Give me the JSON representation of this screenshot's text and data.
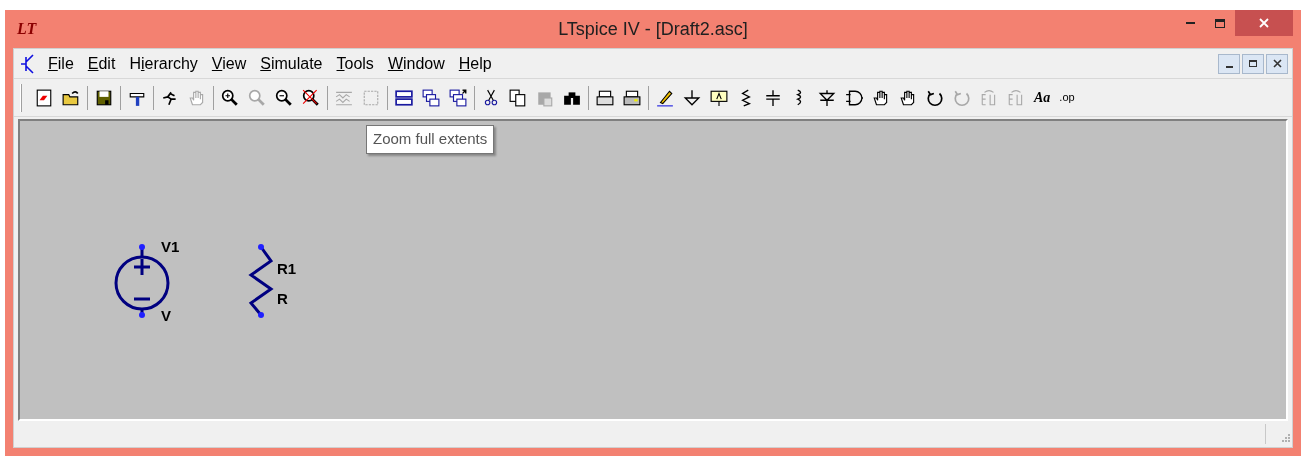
{
  "window": {
    "logo": "LT",
    "title": "LTspice IV - [Draft2.asc]"
  },
  "menu": [
    {
      "key": "F",
      "after": "ile"
    },
    {
      "key": "E",
      "after": "dit"
    },
    {
      "before": "H",
      "key": "i",
      "after": "erarchy"
    },
    {
      "key": "V",
      "after": "iew"
    },
    {
      "key": "S",
      "after": "imulate"
    },
    {
      "key": "T",
      "after": "ools"
    },
    {
      "key": "W",
      "after": "indow"
    },
    {
      "key": "H",
      "after": "elp"
    }
  ],
  "toolbar": [
    [
      {
        "disabled": false
      },
      {
        "disabled": false
      }
    ],
    [
      {
        "disabled": false
      }
    ],
    [
      {
        "disabled": false
      }
    ],
    [
      {
        "disabled": false
      },
      {
        "disabled": true
      }
    ],
    [
      {
        "disabled": false
      },
      {
        "disabled": true
      },
      {
        "disabled": false
      },
      {
        "disabled": false
      }
    ],
    [
      {
        "disabled": true
      },
      {
        "disabled": true
      }
    ],
    [
      {
        "disabled": false
      },
      {
        "disabled": false
      },
      {
        "disabled": false
      }
    ],
    [
      {
        "disabled": false
      },
      {
        "disabled": false
      },
      {
        "disabled": true
      },
      {
        "disabled": false
      }
    ],
    [
      {
        "disabled": false
      },
      {
        "disabled": false
      }
    ],
    [
      {
        "disabled": false
      },
      {
        "disabled": false
      },
      {
        "disabled": false
      },
      {
        "disabled": false
      },
      {
        "disabled": false
      },
      {
        "disabled": false
      },
      {
        "disabled": false
      },
      {
        "disabled": false
      },
      {
        "disabled": false
      },
      {
        "disabled": false
      },
      {
        "disabled": false
      },
      {
        "disabled": true
      },
      {
        "disabled": true
      },
      {
        "disabled": true
      },
      {
        "disabled": false,
        "label": "Aa"
      },
      {
        "disabled": false,
        "label": ".op"
      }
    ]
  ],
  "tooltip": "Zoom full extents",
  "schematic": {
    "source": {
      "name": "V1",
      "value": "V"
    },
    "resistor": {
      "name": "R1",
      "value": "R"
    }
  }
}
